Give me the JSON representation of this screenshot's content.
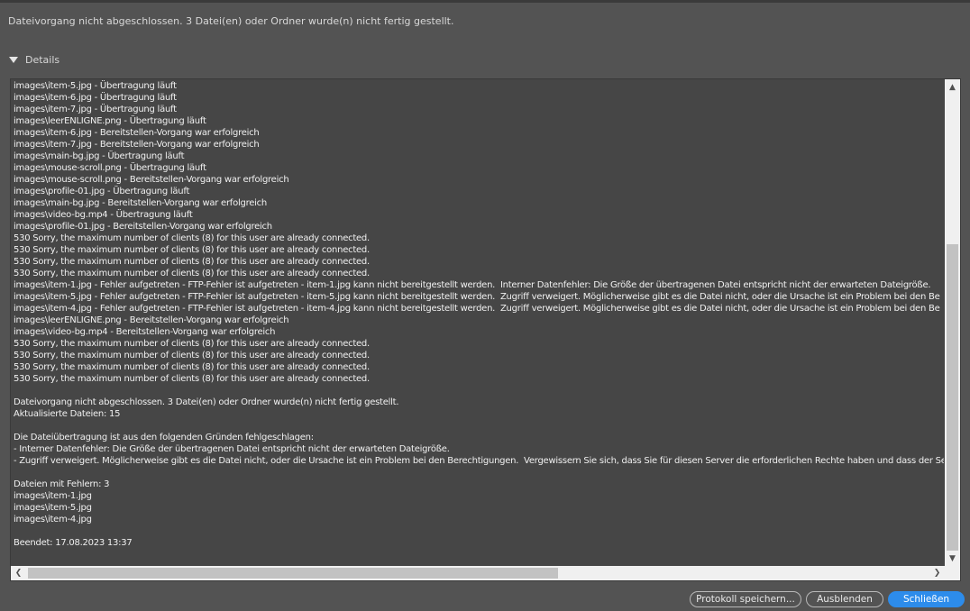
{
  "summary_text": "Dateivorgang nicht abgeschlossen. 3 Datei(en) oder Ordner wurde(n) nicht fertig gestellt.",
  "details": {
    "label": "Details",
    "expanded": true
  },
  "log_lines": [
    "images\\item-5.jpg - Übertragung läuft",
    "images\\item-6.jpg - Übertragung läuft",
    "images\\item-7.jpg - Übertragung läuft",
    "images\\leerENLIGNE.png - Übertragung läuft",
    "images\\item-6.jpg - Bereitstellen-Vorgang war erfolgreich",
    "images\\item-7.jpg - Bereitstellen-Vorgang war erfolgreich",
    "images\\main-bg.jpg - Übertragung läuft",
    "images\\mouse-scroll.png - Übertragung läuft",
    "images\\mouse-scroll.png - Bereitstellen-Vorgang war erfolgreich",
    "images\\profile-01.jpg - Übertragung läuft",
    "images\\main-bg.jpg - Bereitstellen-Vorgang war erfolgreich",
    "images\\video-bg.mp4 - Übertragung läuft",
    "images\\profile-01.jpg - Bereitstellen-Vorgang war erfolgreich",
    "530 Sorry, the maximum number of clients (8) for this user are already connected.",
    "530 Sorry, the maximum number of clients (8) for this user are already connected.",
    "530 Sorry, the maximum number of clients (8) for this user are already connected.",
    "530 Sorry, the maximum number of clients (8) for this user are already connected.",
    "images\\item-1.jpg - Fehler aufgetreten - FTP-Fehler ist aufgetreten - item-1.jpg kann nicht bereitgestellt werden.  Interner Datenfehler: Die Größe der übertragenen Datei entspricht nicht der erwarteten Dateigröße.",
    "images\\item-5.jpg - Fehler aufgetreten - FTP-Fehler ist aufgetreten - item-5.jpg kann nicht bereitgestellt werden.  Zugriff verweigert. Möglicherweise gibt es die Datei nicht, oder die Ursache ist ein Problem bei den Be",
    "images\\item-4.jpg - Fehler aufgetreten - FTP-Fehler ist aufgetreten - item-4.jpg kann nicht bereitgestellt werden.  Zugriff verweigert. Möglicherweise gibt es die Datei nicht, oder die Ursache ist ein Problem bei den Be",
    "images\\leerENLIGNE.png - Bereitstellen-Vorgang war erfolgreich",
    "images\\video-bg.mp4 - Bereitstellen-Vorgang war erfolgreich",
    "530 Sorry, the maximum number of clients (8) for this user are already connected.",
    "530 Sorry, the maximum number of clients (8) for this user are already connected.",
    "530 Sorry, the maximum number of clients (8) for this user are already connected.",
    "530 Sorry, the maximum number of clients (8) for this user are already connected.",
    "",
    "Dateivorgang nicht abgeschlossen. 3 Datei(en) oder Ordner wurde(n) nicht fertig gestellt.",
    "Aktualisierte Dateien: 15",
    "",
    "Die Dateiübertragung ist aus den folgenden Gründen fehlgeschlagen:",
    "- Interner Datenfehler: Die Größe der übertragenen Datei entspricht nicht der erwarteten Dateigröße.",
    "- Zugriff verweigert. Möglicherweise gibt es die Datei nicht, oder die Ursache ist ein Problem bei den Berechtigungen.  Vergewissern Sie sich, dass Sie für diesen Server die erforderlichen Rechte haben und dass der Se",
    "",
    "Dateien mit Fehlern: 3",
    "images\\item-1.jpg",
    "images\\item-5.jpg",
    "images\\item-4.jpg",
    "",
    "Beendet: 17.08.2023 13:37"
  ],
  "buttons": {
    "save_log": "Protokoll speichern...",
    "hide": "Ausblenden",
    "close": "Schließen"
  },
  "colors": {
    "background": "#535353",
    "log_background": "#464646",
    "accent": "#2d8ceb"
  }
}
